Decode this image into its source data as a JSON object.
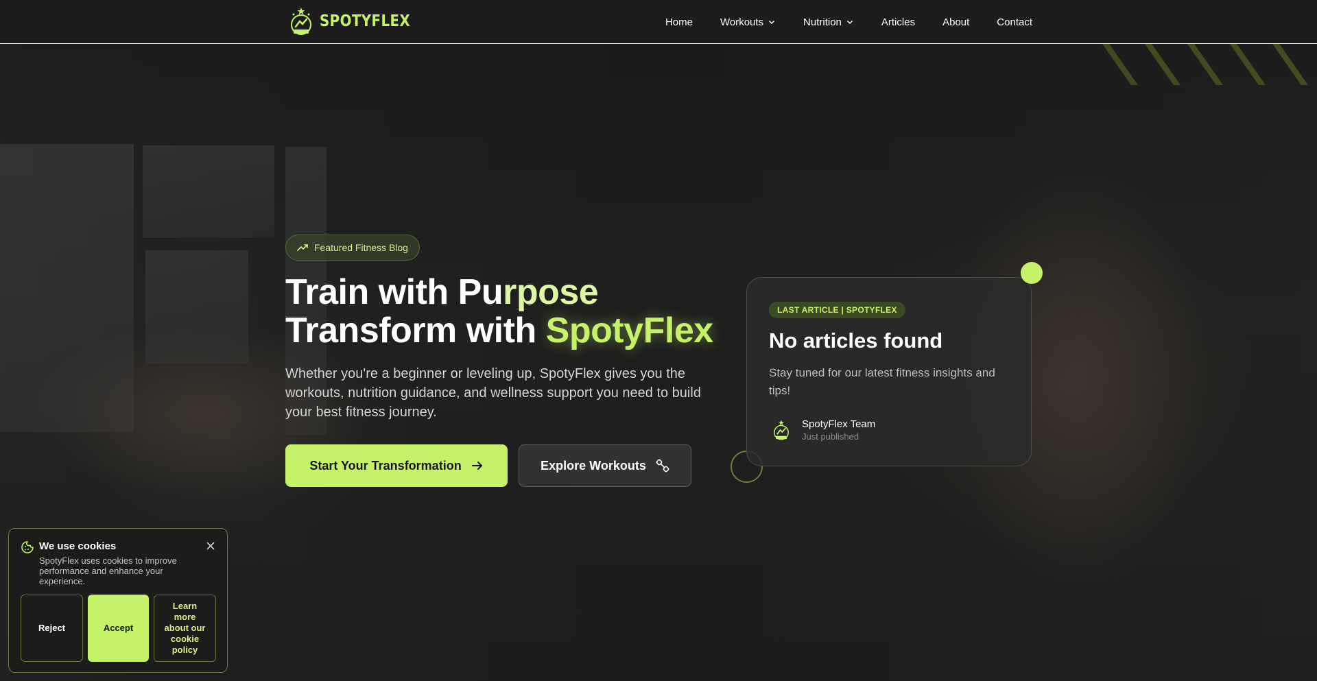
{
  "brand": {
    "name": "SPOTYFLEX",
    "accent": "#c6f26a"
  },
  "nav": {
    "items": [
      {
        "label": "Home"
      },
      {
        "label": "Workouts",
        "has_dropdown": true
      },
      {
        "label": "Nutrition",
        "has_dropdown": true
      },
      {
        "label": "Articles"
      },
      {
        "label": "About"
      },
      {
        "label": "Contact"
      }
    ]
  },
  "hero": {
    "badge": "Featured Fitness Blog",
    "title_line1_a": "Train with Pu",
    "title_line1_b": "rpose",
    "title_line2_a": "Transform with ",
    "title_line2_b": "SpotyFlex",
    "description": "Whether you're a beginner or leveling up, SpotyFlex gives you the workouts, nutrition guidance, and wellness support you need to build your best fitness journey.",
    "primary_cta": "Start Your Transformation",
    "secondary_cta": "Explore Workouts"
  },
  "article_card": {
    "tag": "LAST ARTICLE | SPOTYFLEX",
    "title": "No articles found",
    "description": "Stay tuned for our latest fitness insights and tips!",
    "author_name": "SpotyFlex Team",
    "author_meta": "Just published"
  },
  "cookie": {
    "title": "We use cookies",
    "text": "SpotyFlex uses cookies to improve performance and enhance your experience.",
    "reject": "Reject",
    "accept": "Accept",
    "learn_more": "Learn more about our cookie policy"
  }
}
